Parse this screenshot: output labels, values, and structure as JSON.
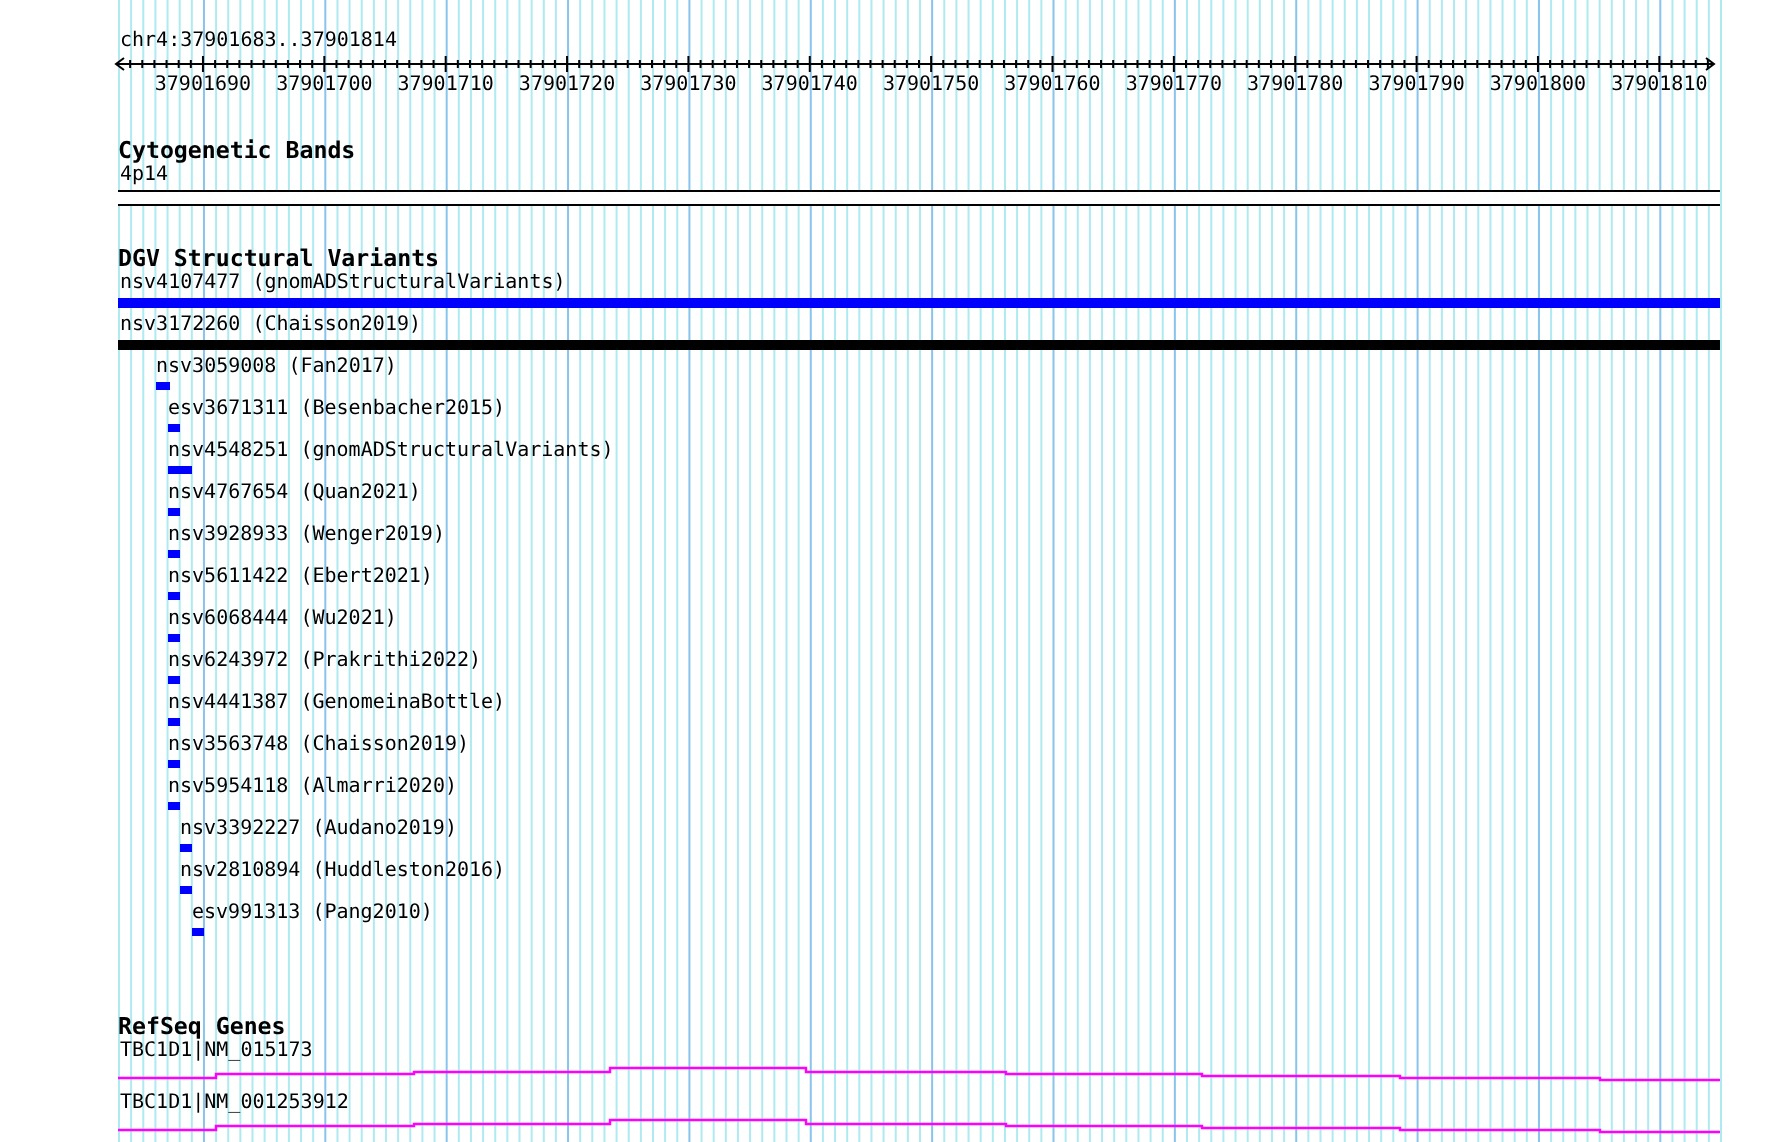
{
  "ruler": {
    "location": "chr4:37901683..37901814",
    "ticks": [
      "37901690",
      "37901700",
      "37901710",
      "37901720",
      "37901730",
      "37901740",
      "37901750",
      "37901760",
      "37901770",
      "37901780",
      "37901790",
      "37901800",
      "37901810"
    ]
  },
  "tracks": [
    {
      "kind": "bands",
      "title": "Cytogenetic Bands",
      "features": [
        {
          "label": "4p14"
        }
      ]
    },
    {
      "kind": "variants",
      "title": "DGV Structural Variants",
      "features": [
        {
          "label": "nsv4107477 (gnomADStructuralVariants)",
          "color": "#0000ff"
        },
        {
          "label": "nsv3172260 (Chaisson2019)",
          "color": "#000000"
        },
        {
          "label": "nsv3059008 (Fan2017)",
          "color": "#0000ff"
        },
        {
          "label": "esv3671311 (Besenbacher2015)",
          "color": "#0000ff"
        },
        {
          "label": "nsv4548251 (gnomADStructuralVariants)",
          "color": "#0000ff"
        },
        {
          "label": "nsv4767654 (Quan2021)",
          "color": "#0000ff"
        },
        {
          "label": "nsv3928933 (Wenger2019)",
          "color": "#0000ff"
        },
        {
          "label": "nsv5611422 (Ebert2021)",
          "color": "#0000ff"
        },
        {
          "label": "nsv6068444 (Wu2021)",
          "color": "#0000ff"
        },
        {
          "label": "nsv6243972 (Prakrithi2022)",
          "color": "#0000ff"
        },
        {
          "label": "nsv4441387 (GenomeinaBottle)",
          "color": "#0000ff"
        },
        {
          "label": "nsv3563748 (Chaisson2019)",
          "color": "#0000ff"
        },
        {
          "label": "nsv5954118 (Almarri2020)",
          "color": "#0000ff"
        },
        {
          "label": "nsv3392227 (Audano2019)",
          "color": "#0000ff"
        },
        {
          "label": "nsv2810894 (Huddleston2016)",
          "color": "#0000ff"
        },
        {
          "label": "esv991313 (Pang2010)",
          "color": "#0000ff"
        }
      ]
    },
    {
      "kind": "genes",
      "title": "RefSeq Genes",
      "features": [
        {
          "label": "TBC1D1|NM_015173"
        },
        {
          "label": "TBC1D1|NM_001253912"
        }
      ]
    }
  ]
}
